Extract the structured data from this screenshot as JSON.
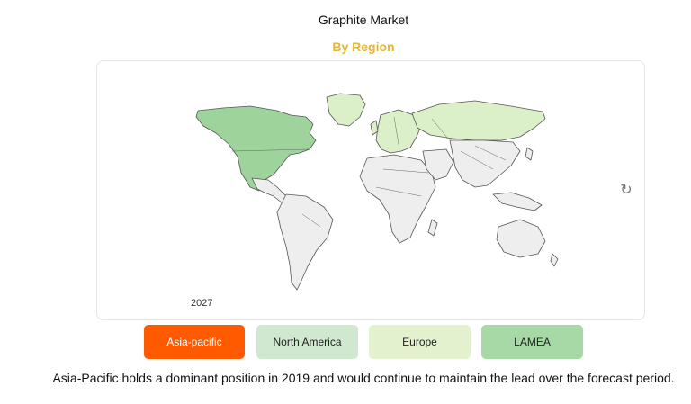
{
  "header": {
    "title": "Graphite Market",
    "subtitle": "By Region"
  },
  "map": {
    "year_label": "2027",
    "refresh_icon": "refresh-icon",
    "colors": {
      "north_america": "#9fd39c",
      "europe": "#dbefc9",
      "other": "#eeeeee",
      "border": "#555555"
    }
  },
  "tabs": [
    {
      "label": "Asia-pacific",
      "bg": "#ff5a00",
      "fg": "#ffffff"
    },
    {
      "label": "North America",
      "bg": "#cfe8cf",
      "fg": "#222222"
    },
    {
      "label": "Europe",
      "bg": "#e3f1cf",
      "fg": "#222222"
    },
    {
      "label": "LAMEA",
      "bg": "#a6d9a6",
      "fg": "#222222"
    }
  ],
  "footer": {
    "text": "Asia-Pacific holds a dominant position in 2019 and would continue to maintain the lead over the forecast period."
  }
}
